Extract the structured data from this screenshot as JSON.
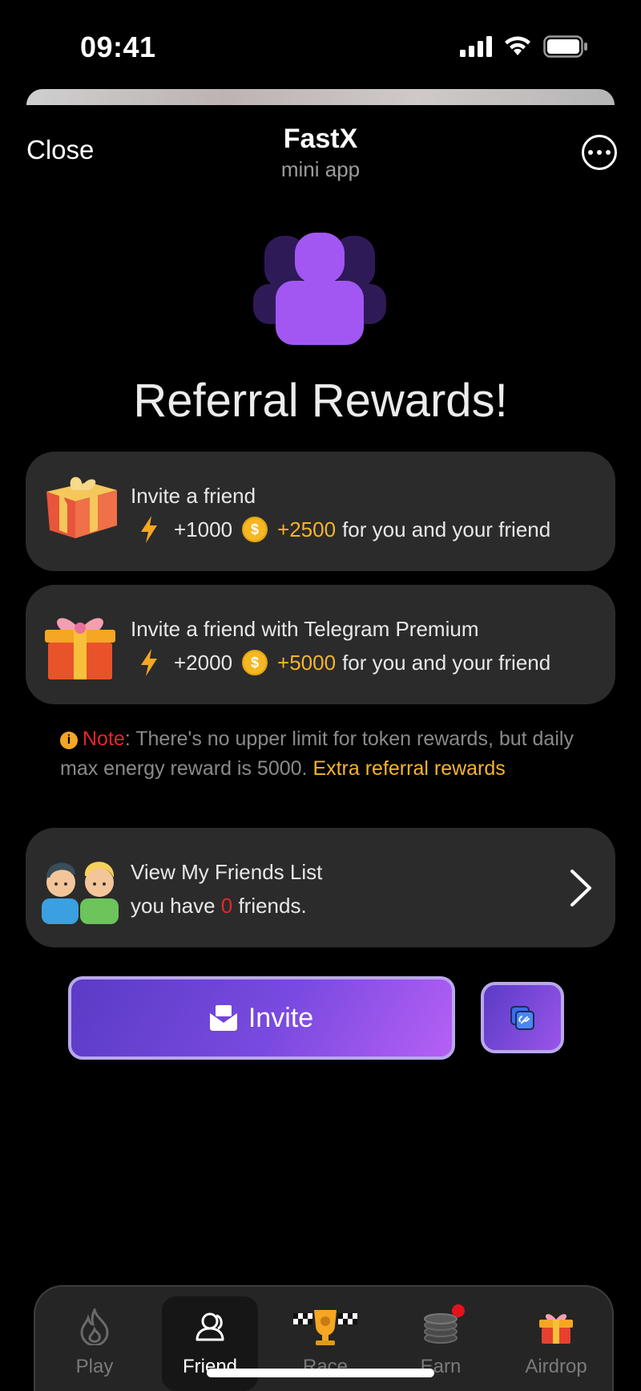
{
  "status_bar": {
    "time": "09:41"
  },
  "header": {
    "close_label": "Close",
    "title": "FastX",
    "subtitle": "mini app"
  },
  "hero": {
    "title": "Referral Rewards!"
  },
  "cards": [
    {
      "title": "Invite a friend",
      "energy": "+1000",
      "tokens": "+2500",
      "suffix": "for you and your friend"
    },
    {
      "title": "Invite a friend with Telegram Premium",
      "energy": "+2000",
      "tokens": "+5000",
      "suffix": "for you and your friend"
    }
  ],
  "note": {
    "label": "Note",
    "text": ": There's no upper limit for token rewards, but daily max energy reward is 5000. ",
    "link": "Extra referral rewards"
  },
  "friends": {
    "title": "View My Friends List",
    "prefix": "you have ",
    "count": "0",
    "suffix": " friends."
  },
  "invite": {
    "label": "Invite"
  },
  "nav": {
    "items": [
      {
        "label": "Play",
        "icon": "flame-icon"
      },
      {
        "label": "Friend",
        "icon": "friend-icon",
        "active": true
      },
      {
        "label": "Race",
        "icon": "trophy-icon"
      },
      {
        "label": "Earn",
        "icon": "coins-icon",
        "badge": true
      },
      {
        "label": "Airdrop",
        "icon": "gift-icon"
      }
    ]
  },
  "colors": {
    "accent_purple": "#7a4ae0",
    "gold": "#f5b42b",
    "alert_red": "#e5262a",
    "card_bg": "#2b2b2b"
  }
}
